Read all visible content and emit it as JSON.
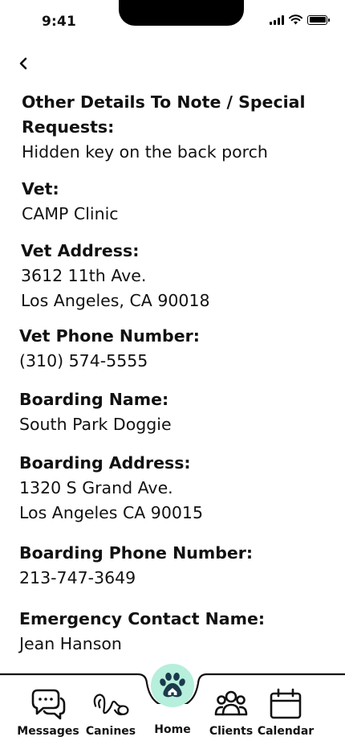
{
  "status_bar": {
    "time": "9:41"
  },
  "details": [
    {
      "label": "Other Details To Note / Special Requests:",
      "value": "Hidden key on the back porch"
    },
    {
      "label": "Vet:",
      "value": "CAMP Clinic"
    },
    {
      "label": "Vet Address:",
      "value_lines": [
        "3612 11th Ave.",
        "Los Angeles, CA 90018"
      ]
    },
    {
      "label": "Vet Phone Number:",
      "value": "(310) 574-5555"
    },
    {
      "label": "Boarding Name:",
      "value": "South Park Doggie"
    },
    {
      "label": "Boarding Address:",
      "value_lines": [
        "1320 S Grand Ave.",
        "Los Angeles CA 90015"
      ]
    },
    {
      "label": "Boarding Phone Number:",
      "value": "213-747-3649"
    },
    {
      "label": "Emergency Contact Name:",
      "value": "Jean Hanson"
    }
  ],
  "nav": {
    "items": [
      {
        "label": "Messages",
        "icon": "messages-icon"
      },
      {
        "label": "Canines",
        "icon": "leash-icon"
      },
      {
        "label": "Home",
        "icon": "paw-home-icon"
      },
      {
        "label": "Clients",
        "icon": "clients-icon"
      },
      {
        "label": "Calendar",
        "icon": "calendar-icon"
      }
    ],
    "active_color": "#b6efdc"
  }
}
